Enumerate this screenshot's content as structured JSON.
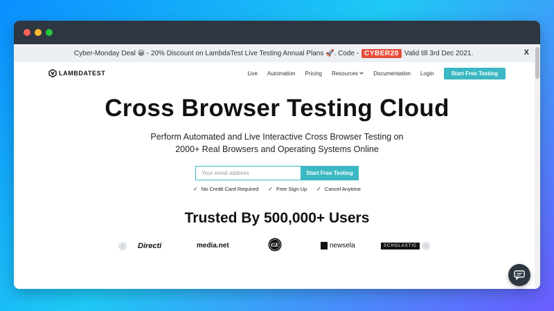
{
  "promo": {
    "text_before": "Cyber-Monday Deal 😀 - 20% Discount on LambdaTest Live Testing Annual Plans 🚀. Code -",
    "code": "CYBER20",
    "text_after": "Valid till 3rd Dec 2021.",
    "close": "X"
  },
  "nav": {
    "logo": "LAMBDATEST",
    "items": [
      "Live",
      "Automation",
      "Pricing",
      "Resources",
      "Documentation",
      "Login"
    ],
    "cta": "Start Free Testing"
  },
  "hero": {
    "title": "Cross Browser Testing Cloud",
    "subtitle_line1": "Perform Automated and Live Interactive Cross Browser Testing on",
    "subtitle_line2": "2000+ Real Browsers and Operating Systems Online",
    "email_placeholder": "Your email address",
    "signup_button": "Start Free Testing",
    "checks": [
      "No Credit Card Required",
      "Free Sign Up",
      "Cancel Anytime"
    ]
  },
  "trusted": {
    "title": "Trusted By 500,000+ Users",
    "brands": [
      "Directi",
      "media.net",
      "GE",
      "newsela",
      "SCHOLASTIC"
    ]
  },
  "icons": {
    "chevron": "chevron-down-icon",
    "check": "check-icon",
    "chat": "chat-icon",
    "arrow_prev": "chevron-left-icon",
    "arrow_next": "chevron-right-icon"
  },
  "colors": {
    "accent": "#3bb8c3",
    "code_badge": "#e74c3c",
    "titlebar": "#2d3641"
  }
}
